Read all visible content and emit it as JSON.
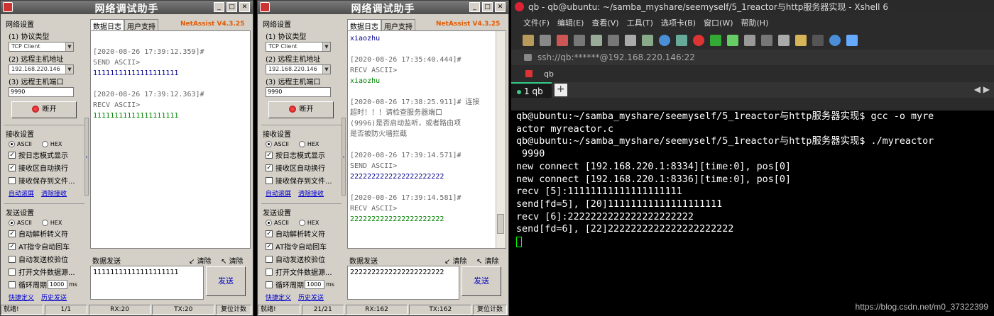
{
  "left": {
    "title": "网络调试助手",
    "version": "NetAssist V4.3.25",
    "net": {
      "group": "网络设置",
      "proto_label": "(1) 协议类型",
      "proto_value": "TCP Client",
      "host_label": "(2) 远程主机地址",
      "host_value": "192.168.220.146",
      "port_label": "(3) 远程主机端口",
      "port_value": "9990",
      "disconnect": "断开"
    },
    "recv": {
      "group": "接收设置",
      "ascii": "ASCII",
      "hex": "HEX",
      "opt1": "按日志模式显示",
      "opt2": "接收区自动换行",
      "opt3": "接收保存到文件...",
      "link1": "自动滚屏",
      "link2": "清除接收"
    },
    "send": {
      "group": "发送设置",
      "ascii": "ASCII",
      "hex": "HEX",
      "opt1": "自动解析转义符",
      "opt2": "AT指令自动回车",
      "opt3": "自动发送校验位",
      "opt4": "打开文件数据源...",
      "opt5": "循环周期",
      "period": "1000",
      "unit": "ms",
      "link1": "快捷定义",
      "link2": "历史发送"
    },
    "tab_log": "数据日志",
    "tab_user": "用户支持",
    "log": [
      {
        "cls": "g",
        "text": "[2020-08-26 17:39:12.359]#"
      },
      {
        "cls": "g",
        "text": "SEND ASCII>"
      },
      {
        "cls": "b",
        "text": "11111111111111111111"
      },
      {
        "cls": "",
        "text": ""
      },
      {
        "cls": "g",
        "text": "[2020-08-26 17:39:12.363]#"
      },
      {
        "cls": "g",
        "text": "RECV ASCII>"
      },
      {
        "cls": "gr",
        "text": "11111111111111111111"
      }
    ],
    "send_label": "数据发送",
    "clear1": "清除",
    "clear2": "清除",
    "send_text": "11111111111111111111",
    "send_btn": "发送",
    "status": [
      "就绪!",
      "1/1",
      "RX:20",
      "TX:20",
      "复位计数"
    ]
  },
  "mid": {
    "title": "网络调试助手",
    "version": "NetAssist V4.3.25",
    "net": {
      "group": "网络设置",
      "proto_label": "(1) 协议类型",
      "proto_value": "TCP Client",
      "host_label": "(2) 远程主机地址",
      "host_value": "192.168.220.146",
      "port_label": "(3) 远程主机端口",
      "port_value": "9990",
      "disconnect": "断开"
    },
    "recv": {
      "group": "接收设置",
      "ascii": "ASCII",
      "hex": "HEX",
      "opt1": "按日志模式显示",
      "opt2": "接收区自动换行",
      "opt3": "接收保存到文件...",
      "link1": "自动滚屏",
      "link2": "清除接收"
    },
    "send": {
      "group": "发送设置",
      "ascii": "ASCII",
      "hex": "HEX",
      "opt1": "自动解析转义符",
      "opt2": "AT指令自动回车",
      "opt3": "自动发送校验位",
      "opt4": "打开文件数据源...",
      "opt5": "循环周期",
      "period": "1000",
      "unit": "ms",
      "link1": "快捷定义",
      "link2": "历史发送"
    },
    "tab_log": "数据日志",
    "tab_user": "用户支持",
    "log": [
      {
        "cls": "b",
        "text": "xiaozhu"
      },
      {
        "cls": "",
        "text": ""
      },
      {
        "cls": "g",
        "text": "[2020-08-26 17:35:40.444]#"
      },
      {
        "cls": "g",
        "text": "RECV ASCII>"
      },
      {
        "cls": "gr",
        "text": "xiaozhu"
      },
      {
        "cls": "",
        "text": ""
      },
      {
        "cls": "g",
        "text": "[2020-08-26 17:38:25.911]# 连接"
      },
      {
        "cls": "g",
        "text": "超时！！！请检查服务器端口"
      },
      {
        "cls": "g",
        "text": "(9996)是否启动监听，或者路由项"
      },
      {
        "cls": "g",
        "text": "是否被防火墙拦截"
      },
      {
        "cls": "",
        "text": ""
      },
      {
        "cls": "g",
        "text": "[2020-08-26 17:39:14.571]#"
      },
      {
        "cls": "g",
        "text": "SEND ASCII>"
      },
      {
        "cls": "b",
        "text": "2222222222222222222222"
      },
      {
        "cls": "",
        "text": ""
      },
      {
        "cls": "g",
        "text": "[2020-08-26 17:39:14.581]#"
      },
      {
        "cls": "g",
        "text": "RECV ASCII>"
      },
      {
        "cls": "gr",
        "text": "2222222222222222222222"
      }
    ],
    "send_label": "数据发送",
    "clear1": "清除",
    "clear2": "清除",
    "send_text": "2222222222222222222222",
    "send_btn": "发送",
    "status": [
      "就绪!",
      "21/21",
      "RX:162",
      "TX:162",
      "复位计数"
    ]
  },
  "xshell": {
    "title": "qb - qb@ubuntu: ~/samba_myshare/seemyself/5_1reactor与http服务器实现 - Xshell 6",
    "menu": [
      "文件(F)",
      "编辑(E)",
      "查看(V)",
      "工具(T)",
      "选项卡(B)",
      "窗口(W)",
      "帮助(H)"
    ],
    "address": "ssh://qb:******@192.168.220.146:22",
    "session": "qb",
    "tab": "1 qb",
    "plus": "+",
    "nav": "◀ ▶",
    "lines": [
      "qb@ubuntu:~/samba_myshare/seemyself/5_1reactor与http服务器实现$ gcc -o myre",
      "actor myreactor.c",
      "qb@ubuntu:~/samba_myshare/seemyself/5_1reactor与http服务器实现$ ./myreactor",
      " 9990",
      "new connect [192.168.220.1:8334][time:0], pos[0]",
      "new connect [192.168.220.1:8336][time:0], pos[0]",
      "recv [5]:11111111111111111111",
      "send[fd=5], [20]11111111111111111111",
      "recv [6]:2222222222222222222222",
      "send[fd=6], [22]2222222222222222222222"
    ],
    "watermark": "https://blog.csdn.net/m0_37322399"
  }
}
